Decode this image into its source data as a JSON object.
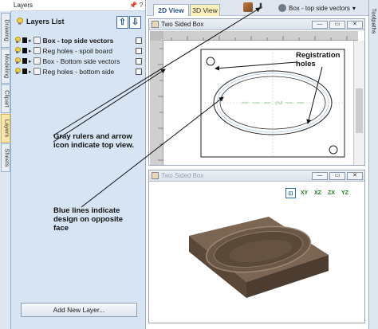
{
  "panel": {
    "title": "Layers",
    "pin_label": "📌",
    "help_label": "?",
    "heading": "Layers List",
    "up_arrow": "⇧",
    "down_arrow": "⇩",
    "layers": [
      {
        "name": "Box - top side vectors",
        "selected": true
      },
      {
        "name": "Reg holes - spoil board",
        "selected": false
      },
      {
        "name": "Box - Bottom side vectors",
        "selected": false
      },
      {
        "name": "Reg holes - bottom side",
        "selected": false
      }
    ],
    "add_button": "Add New Layer..."
  },
  "vertical_tabs": [
    "Drawing",
    "Modeling",
    "Clipart",
    "Layers",
    "Sheets"
  ],
  "topbar": {
    "tab_2d": "2D View",
    "tab_3d": "3D View",
    "sheet_dropdown": "Box - top side vectors"
  },
  "right_strip": "Toolpaths",
  "window_2d": {
    "title": "Two Sided Box",
    "btn_min": "—",
    "btn_max": "▭",
    "btn_close": "✕"
  },
  "window_3d": {
    "title": "Two Sided Box",
    "btn_min": "—",
    "btn_max": "▭",
    "btn_close": "✕"
  },
  "axis_icons": [
    "⊡",
    "XY",
    "XZ",
    "ZX",
    "YZ"
  ],
  "annotations": {
    "registration": "Registration holes",
    "rulers": "Gray rulers and arrow icon indicate top view.",
    "blue_lines": "Blue lines indicate design on opposite face"
  },
  "colors": {
    "panel_bg": "#d6e4f3",
    "wood_top": "#7d6a57",
    "wood_side": "#5c4a3b",
    "active_tab": "#fbe7a6"
  }
}
